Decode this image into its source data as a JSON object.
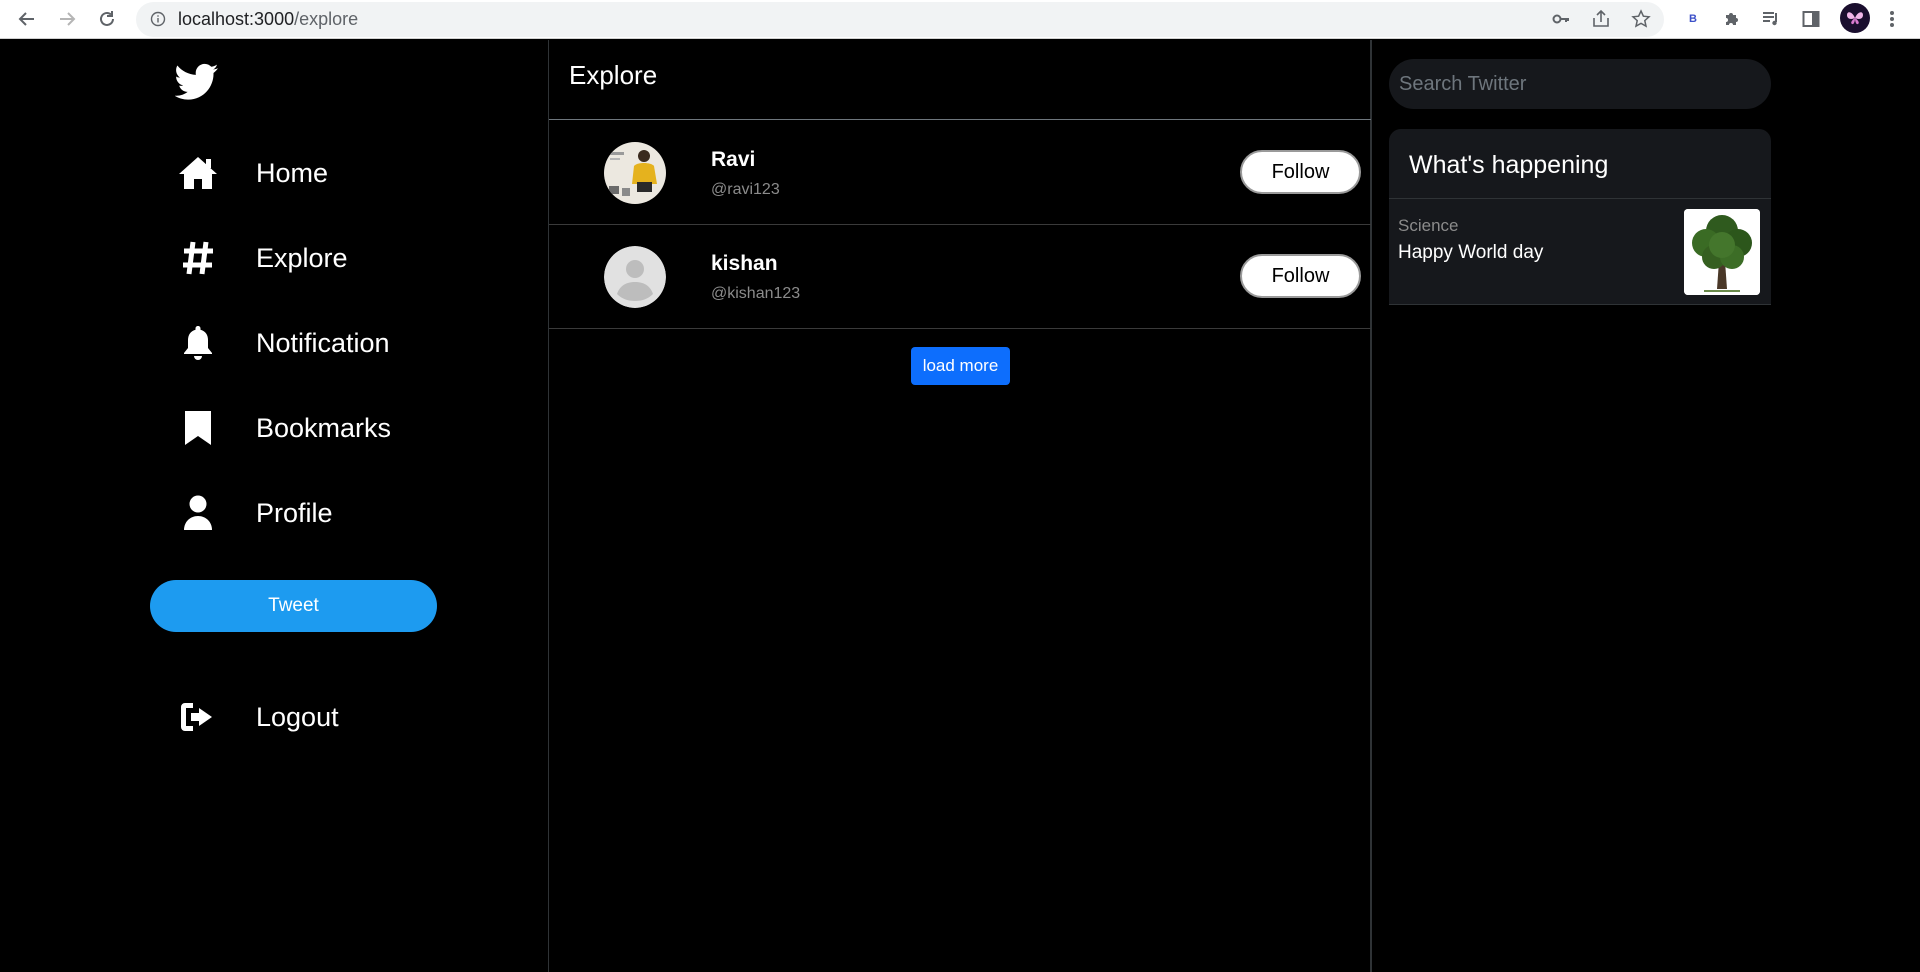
{
  "browser": {
    "url_host": "localhost:3000",
    "url_path": "/explore",
    "extension_badge": "B"
  },
  "sidebar": {
    "logo": "twitter-bird-icon",
    "items": [
      {
        "label": "Home",
        "icon": "home-icon"
      },
      {
        "label": "Explore",
        "icon": "hashtag-icon"
      },
      {
        "label": "Notification",
        "icon": "bell-icon"
      },
      {
        "label": "Bookmarks",
        "icon": "bookmark-icon"
      },
      {
        "label": "Profile",
        "icon": "user-icon"
      }
    ],
    "tweet_label": "Tweet",
    "logout_label": "Logout"
  },
  "main": {
    "title": "Explore",
    "users": [
      {
        "name": "Ravi",
        "handle": "@ravi123",
        "follow_label": "Follow",
        "avatar": "photo"
      },
      {
        "name": "kishan",
        "handle": "@kishan123",
        "follow_label": "Follow",
        "avatar": "default"
      }
    ],
    "load_more_label": "load more"
  },
  "right": {
    "search_placeholder": "Search Twitter",
    "happening_title": "What's happening",
    "trend": {
      "category": "Science",
      "title": "Happy World day",
      "image": "tree-image"
    }
  },
  "colors": {
    "accent": "#1d9bf0",
    "load_more": "#0d6efd",
    "background": "#000000",
    "panel": "#16181c"
  }
}
